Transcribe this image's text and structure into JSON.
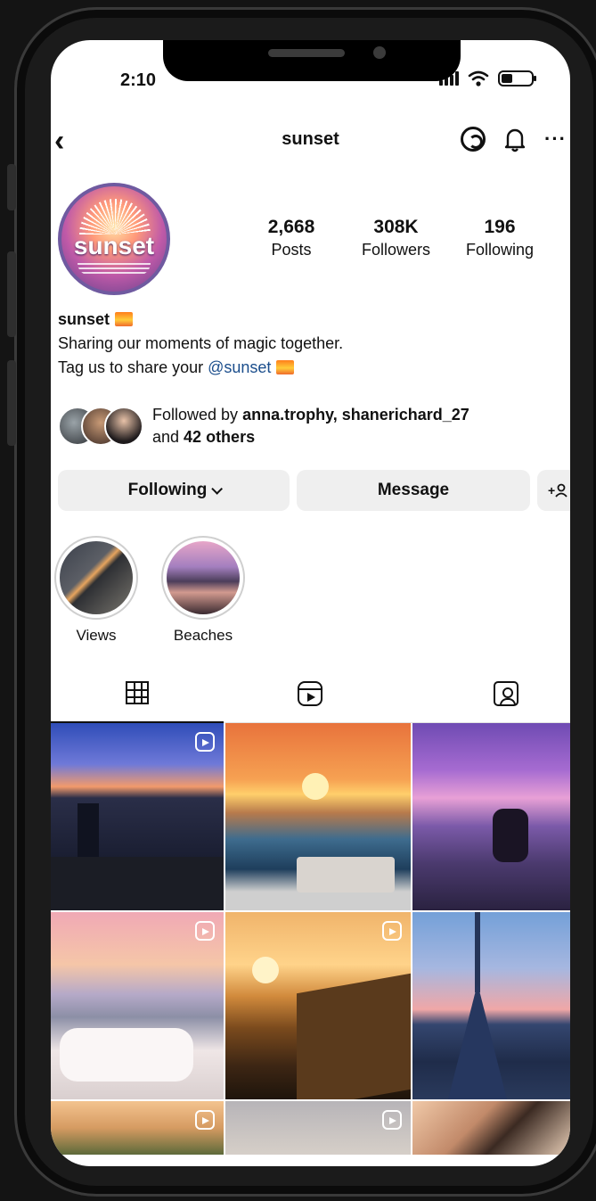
{
  "status": {
    "time": "2:10"
  },
  "header": {
    "handle": "sunset"
  },
  "profile": {
    "avatar_text": "sunset",
    "stats": [
      {
        "value": "2,668",
        "label": "Posts"
      },
      {
        "value": "308K",
        "label": "Followers"
      },
      {
        "value": "196",
        "label": "Following"
      }
    ],
    "name": "sunset",
    "bio_line1": "Sharing our moments of magic together.",
    "bio_line2_prefix": "Tag us to share your ",
    "bio_mention": "@sunset",
    "followed_by_prefix": "Followed by ",
    "followed_by_users": "anna.trophy, shanerichard_27",
    "followed_by_and": "and ",
    "followed_by_others": "42 others"
  },
  "actions": {
    "following_label": "Following",
    "message_label": "Message",
    "add_user_label": "+"
  },
  "highlights": [
    {
      "label": "Views"
    },
    {
      "label": "Beaches"
    }
  ],
  "tabs": [
    "grid-icon",
    "reels-icon",
    "tagged-icon"
  ],
  "grid": {
    "count": 9
  },
  "colors": {
    "mention": "#1b4e8c",
    "button_bg": "#efefef",
    "avatar_ring": "#6f5aa0"
  }
}
